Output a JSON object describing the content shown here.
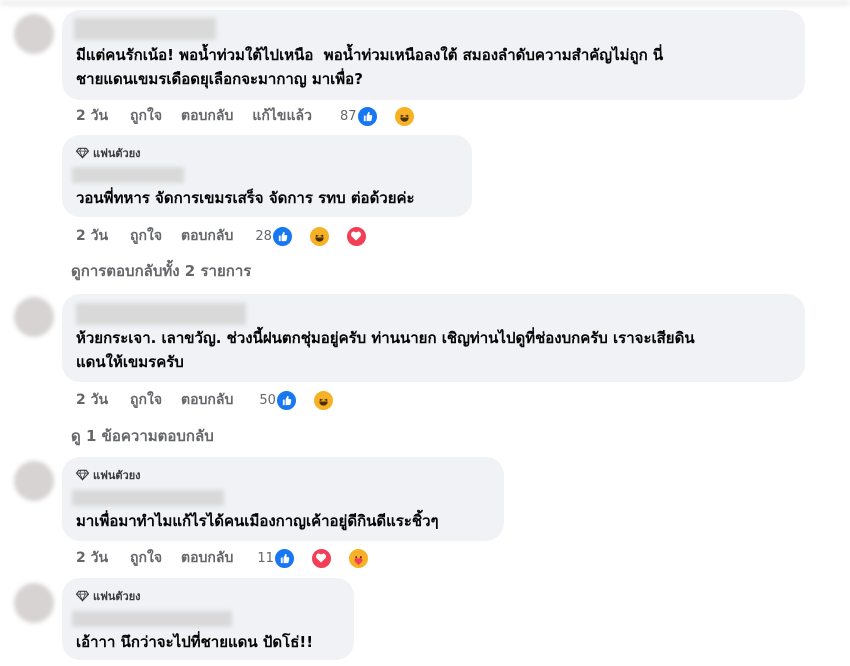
{
  "badge_label": "แฟนตัวยง",
  "comments": [
    {
      "text": "มีแต่คนรักเน้อ! พอน้ำท่วมใต้ไปเหนือ  พอน้ำท่วมเหนือลงใต้ สมองลำดับความสำคัญไม่ถูก นี่\nชายแดนเขมรเดือดยุเลือกจะมากาญ มาเพื่อ?",
      "time": "2 วัน",
      "like": "ถูกใจ",
      "reply": "ตอบกลับ",
      "edited": "แก้ไขแล้ว",
      "count": "87",
      "reactions": [
        "like-icon",
        "haha-icon"
      ]
    },
    {
      "badge": true,
      "text": "วอนพี่ทหาร จัดการเขมรเสร็จ จัดการ รทบ ต่อด้วยค่ะ",
      "time": "2 วัน",
      "like": "ถูกใจ",
      "reply": "ตอบกลับ",
      "count": "28",
      "reactions": [
        "like-icon",
        "haha-icon",
        "love-icon"
      ]
    },
    {
      "text": "ห้วยกระเจา. เลาขวัญ. ช่วงนี้ฝนตกชุ่มอยู่ครับ ท่านนายก เชิญท่านไปดูที่ช่องบกครับ เราจะเสียดิน\nแดนให้เขมรครับ",
      "time": "2 วัน",
      "like": "ถูกใจ",
      "reply": "ตอบกลับ",
      "count": "50",
      "reactions": [
        "like-icon",
        "haha-icon"
      ]
    },
    {
      "badge": true,
      "text": "มาเพื่อมาทำไมแก้ไรได้คนเมืองกาญเค้าอยู่ดีกินดีแระชิ้วๆ",
      "time": "2 วัน",
      "like": "ถูกใจ",
      "reply": "ตอบกลับ",
      "count": "11",
      "reactions": [
        "like-icon",
        "love-icon",
        "care-icon"
      ]
    },
    {
      "badge": true,
      "text": "เอ้าาา นึกว่าจะไปที่ชายแดน ปัดโธ่!!"
    }
  ],
  "view_replies": [
    "ดูการตอบกลับทั้ง 2 รายการ",
    "ดู 1 ข้อความตอบกลับ"
  ]
}
